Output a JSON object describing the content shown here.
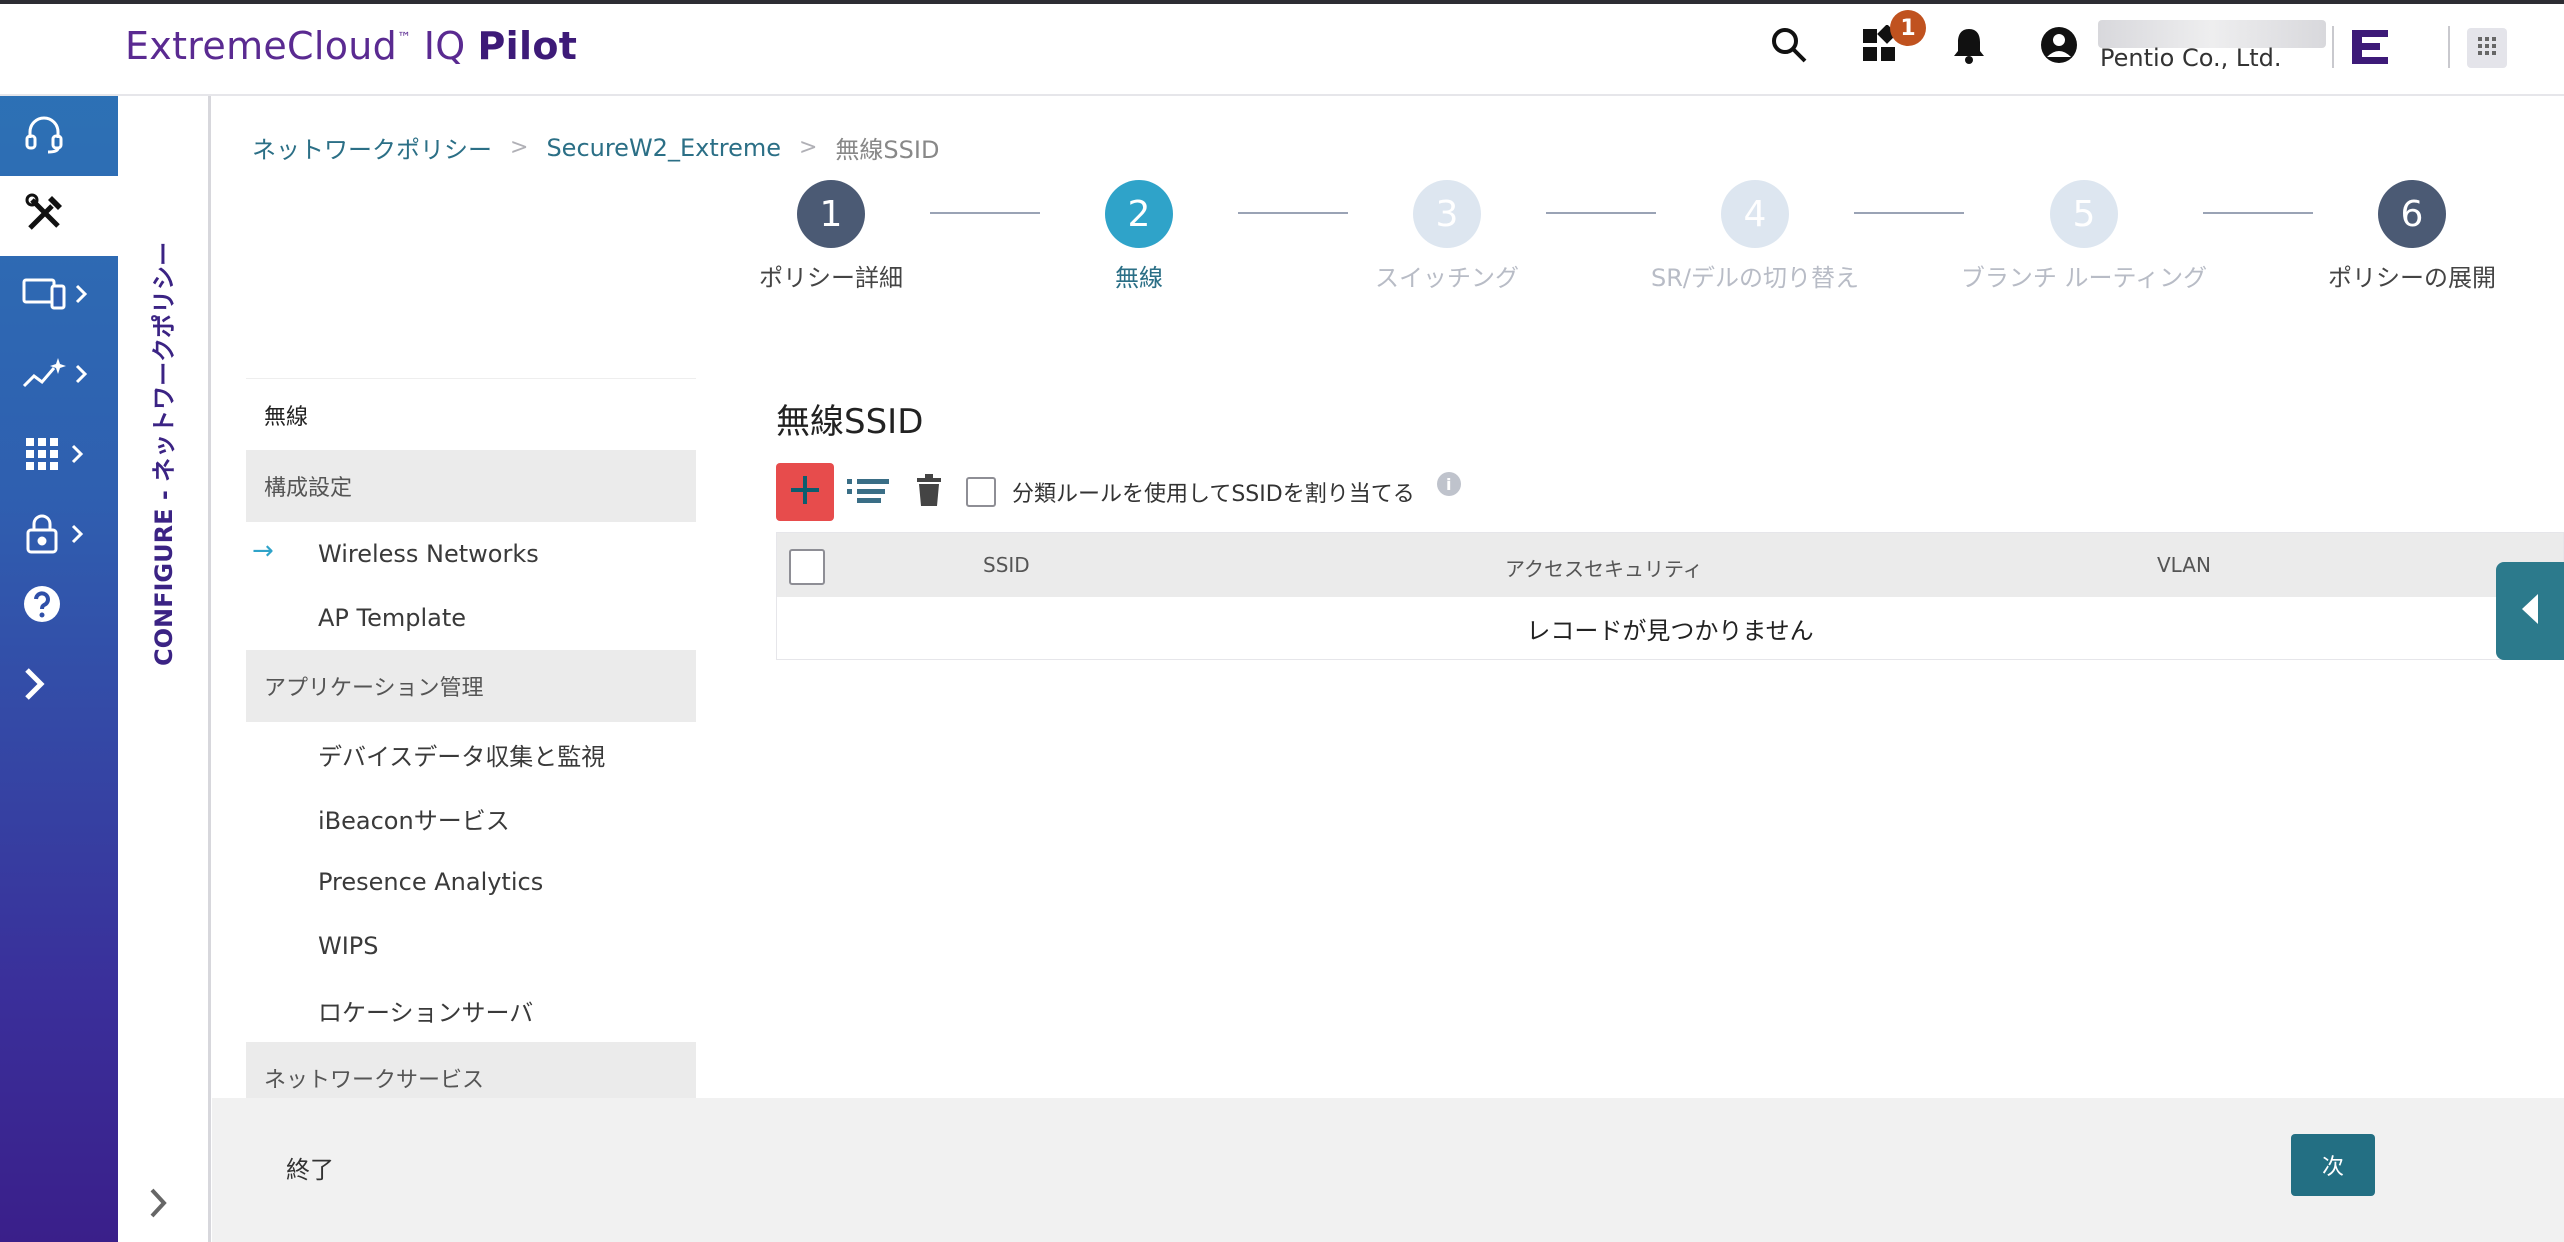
{
  "app": {
    "brand_main": "ExtremeCloud",
    "brand_tm": "™",
    "brand_iq": " IQ",
    "brand_pilot": "Pilot"
  },
  "header": {
    "notifications_badge": "1",
    "company": "Pentio Co., Ltd."
  },
  "side_label": "CONFIGURE - ネットワークポリシー",
  "breadcrumb": {
    "item1": "ネットワークポリシー",
    "item2": "SecureW2_Extreme",
    "current": "無線SSID",
    "separator": ">"
  },
  "stepper": [
    {
      "number": "1",
      "label": "ポリシー詳細",
      "state": "done"
    },
    {
      "number": "2",
      "label": "無線",
      "state": "active"
    },
    {
      "number": "3",
      "label": "スイッチング",
      "state": "future"
    },
    {
      "number": "4",
      "label": "SR/デルの切り替え",
      "state": "future"
    },
    {
      "number": "5",
      "label": "ブランチ ルーティング",
      "state": "future"
    },
    {
      "number": "6",
      "label": "ポリシーの展開",
      "state": "done"
    }
  ],
  "subnav": {
    "title": "無線",
    "group1": "構成設定",
    "wireless_networks": "Wireless Networks",
    "ap_template": "AP Template",
    "group2": "アプリケーション管理",
    "device_data": "デバイスデータ収集と監視",
    "ibeacon": "iBeaconサービス",
    "presence": "Presence Analytics",
    "wips": "WIPS",
    "location": "ロケーションサーバ",
    "group3": "ネットワークサービス"
  },
  "content": {
    "title": "無線SSID",
    "classify_label": "分類ルールを使用してSSIDを割り当てる",
    "columns": {
      "ssid": "SSID",
      "access_security": "アクセスセキュリティ",
      "vlan": "VLAN"
    },
    "no_records": "レコードが見つかりません"
  },
  "footer": {
    "finish": "終了",
    "next": "次"
  },
  "colors": {
    "brand": "#5a2a91",
    "active_step": "#2fa3c9",
    "done_step": "#4b5a74",
    "add_button": "#e74c4c",
    "next_button": "#236f83"
  }
}
